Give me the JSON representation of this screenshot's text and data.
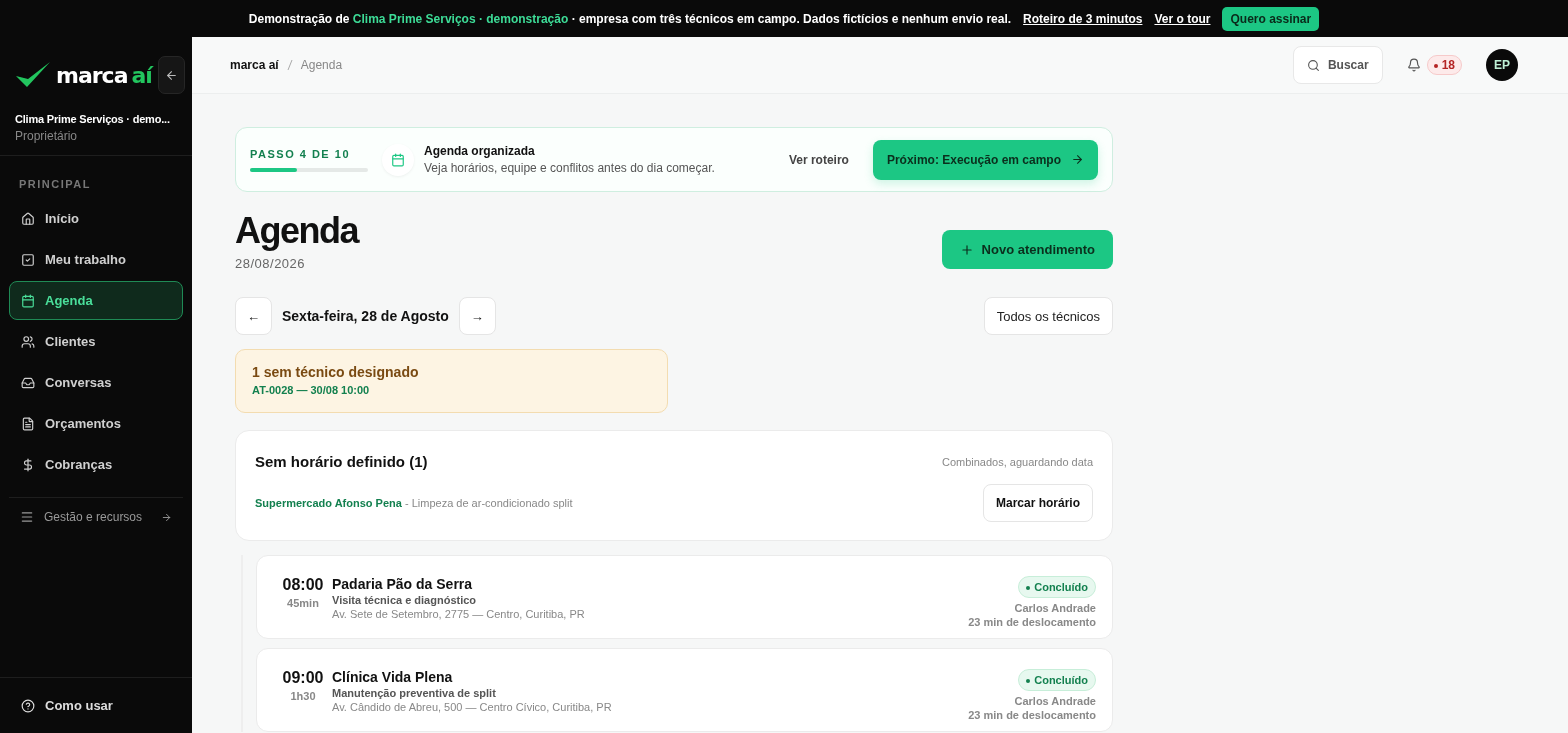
{
  "banner": {
    "prefix": "Demonstração de",
    "highlight": "Clima Prime Serviços · demonstração",
    "suffix": "· empresa com três técnicos em campo. Dados fictícios e nenhum envio real.",
    "links": [
      "Roteiro de 3 minutos",
      "Ver o tour"
    ],
    "cta": "Quero assinar"
  },
  "sidebar": {
    "logo": {
      "word": "marca",
      "accent": "aí"
    },
    "company": "Clima Prime Serviços · demo...",
    "role": "Proprietário",
    "section": "PRINCIPAL",
    "items": [
      {
        "label": "Início",
        "selected": false
      },
      {
        "label": "Meu trabalho",
        "selected": false
      },
      {
        "label": "Agenda",
        "selected": true
      },
      {
        "label": "Clientes",
        "selected": false
      },
      {
        "label": "Conversas",
        "selected": false
      },
      {
        "label": "Orçamentos",
        "selected": false
      },
      {
        "label": "Cobranças",
        "selected": false
      }
    ],
    "more": "Gestão e recursos",
    "help": "Como usar"
  },
  "header": {
    "breadcrumb": [
      "marca aí",
      "Agenda"
    ],
    "search": "Buscar",
    "notifications": "18",
    "avatar": "EP"
  },
  "onboarding": {
    "step": "PASSO 4 DE 10",
    "level": 0.4,
    "title": "Agenda organizada",
    "description": "Veja horários, equipe e conflitos antes do dia começar.",
    "secondary": "Ver roteiro",
    "primary": "Próximo: Execução em campo"
  },
  "page": {
    "title": "Agenda",
    "date": "28/08/2026",
    "new_button": "Novo atendimento",
    "prev": "←",
    "day": "Sexta-feira, 28 de Agosto",
    "next": "→",
    "filter": "Todos os técnicos"
  },
  "alert": {
    "title": "1 sem técnico designado",
    "detail": "AT-0028 — 30/08 10:00"
  },
  "unscheduled": {
    "title": "Sem horário definido (1)",
    "note": "Combinados, aguardando data",
    "client": "Supermercado Afonso Pena",
    "service": "- Limpeza de ar-condicionado split",
    "button": "Marcar horário"
  },
  "appointments": [
    {
      "time": "08:00",
      "duration": "45min",
      "client": "Padaria Pão da Serra",
      "service": "Visita técnica e diagnóstico",
      "address": "Av. Sete de Setembro, 2775 — Centro, Curitiba, PR",
      "status": "Concluído",
      "technician": "Carlos Andrade",
      "travel": "23 min de deslocamento"
    },
    {
      "time": "09:00",
      "duration": "1h30",
      "client": "Clínica Vida Plena",
      "service": "Manutenção preventiva de split",
      "address": "Av. Cândido de Abreu, 500 — Centro Cívico, Curitiba, PR",
      "status": "Concluído",
      "technician": "Carlos Andrade",
      "travel": "23 min de deslocamento"
    }
  ]
}
